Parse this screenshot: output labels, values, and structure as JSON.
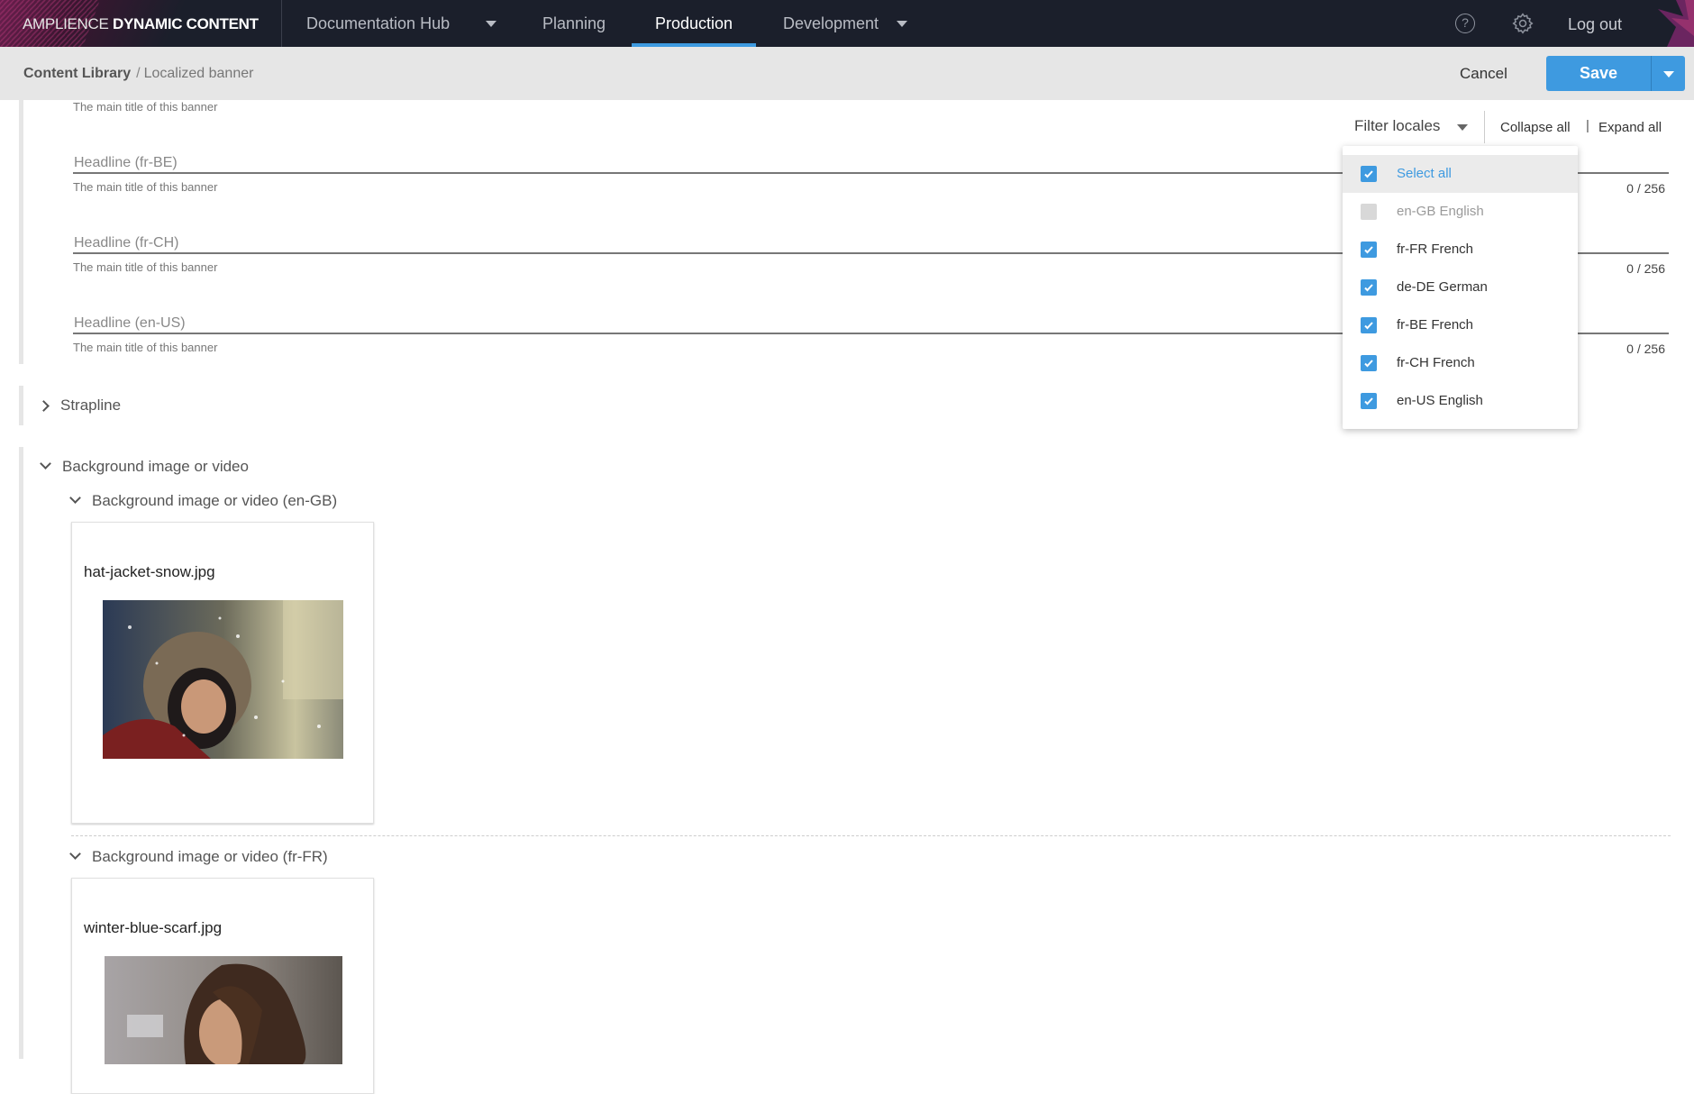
{
  "topnav": {
    "brand_light": "AMPLIENCE",
    "brand_bold": "DYNAMIC CONTENT",
    "hub": "Documentation Hub",
    "tabs": [
      {
        "label": "Planning",
        "active": false
      },
      {
        "label": "Production",
        "active": true
      },
      {
        "label": "Development",
        "active": false
      }
    ],
    "help_icon": "?",
    "logout": "Log out"
  },
  "subbar": {
    "breadcrumb_root": "Content Library",
    "breadcrumb_sep": "/",
    "breadcrumb_leaf": "Localized banner",
    "cancel": "Cancel",
    "save": "Save"
  },
  "toolbar": {
    "filter_locales": "Filter locales",
    "collapse_all": "Collapse all",
    "pipe": "|",
    "expand_all": "Expand all"
  },
  "locale_filter": {
    "items": [
      {
        "label": "Select all",
        "checked": true
      },
      {
        "label": "en-GB English",
        "checked": false
      },
      {
        "label": "fr-FR French",
        "checked": true
      },
      {
        "label": "de-DE German",
        "checked": true
      },
      {
        "label": "fr-BE French",
        "checked": true
      },
      {
        "label": "fr-CH French",
        "checked": true
      },
      {
        "label": "en-US English",
        "checked": true
      }
    ]
  },
  "headline": {
    "help_text": "The main title of this banner",
    "fields": [
      {
        "label": "Headline (fr-BE)",
        "help": "The main title of this banner",
        "value": "",
        "counter": "0 / 256"
      },
      {
        "label": "Headline (fr-CH)",
        "help": "The main title of this banner",
        "value": "",
        "counter": "0 / 256"
      },
      {
        "label": "Headline (en-US)",
        "help": "The main title of this banner",
        "value": "",
        "counter": "0 / 256"
      }
    ]
  },
  "strapline": {
    "label": "Strapline"
  },
  "background": {
    "label": "Background image or video",
    "locales": [
      {
        "label": "Background image or video (en-GB)",
        "file": "hat-jacket-snow.jpg"
      },
      {
        "label": "Background image or video (fr-FR)",
        "file": "winter-blue-scarf.jpg"
      }
    ]
  }
}
